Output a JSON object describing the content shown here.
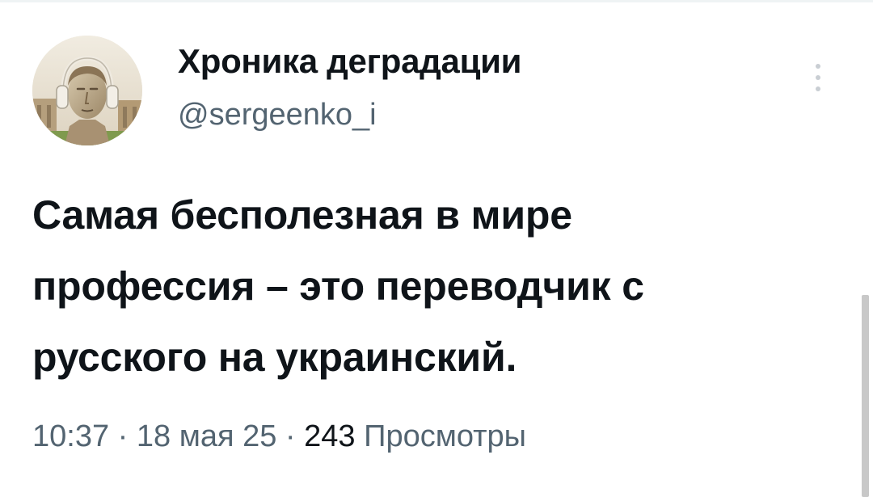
{
  "tweet": {
    "author": {
      "display_name": "Хроника деградации",
      "handle": "@sergeenko_i",
      "avatar_icon": "avatar-bust-with-headphones"
    },
    "more_icon": "more-vertical-icon",
    "text_lines": [
      "Самая бесполезная в мире",
      "профессия – это переводчик с",
      "русского на украинский."
    ],
    "time": "10:37",
    "separator": " · ",
    "date": "18 мая 25",
    "views_count": "243",
    "views_label": "Просмотры"
  },
  "colors": {
    "text_primary": "#0f1419",
    "text_secondary": "#536471",
    "background": "#ffffff"
  }
}
